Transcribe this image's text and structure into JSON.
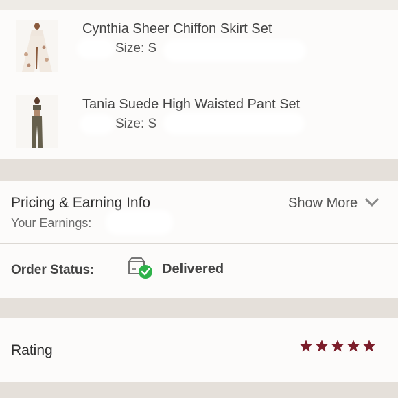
{
  "items": [
    {
      "title": "Cynthia Sheer Chiffon Skirt Set",
      "size": "Size: S"
    },
    {
      "title": "Tania Suede High Waisted Pant Set",
      "size": "Size: S"
    }
  ],
  "pricing": {
    "heading": "Pricing & Earning Info",
    "show_more": "Show More",
    "earnings_label": "Your Earnings:"
  },
  "order": {
    "label": "Order Status:",
    "status": "Delivered"
  },
  "rating": {
    "label": "Rating",
    "stars": 5,
    "star_color": "#7b1d2a"
  },
  "colors": {
    "check": "#2eb24a",
    "star": "#7b1d2a"
  }
}
